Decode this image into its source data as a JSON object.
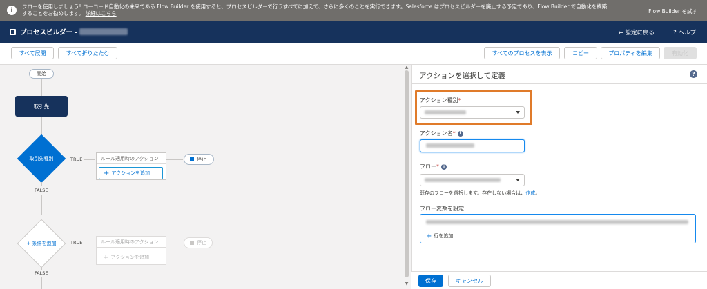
{
  "notice": {
    "text": "フローを使用しましょう! ローコード自動化の未来である Flow Builder を使用すると、プロセスビルダーで行うすべてに加えて、さらに多くのことを実行できます。Salesforce はプロセスビルダーを廃止する予定であり、Flow Builder で自動化を構築することをお勧めします。",
    "link": "詳細はこちら",
    "try_label": "Flow Builder を試す"
  },
  "header": {
    "title": "プロセスビルダー -",
    "back_label": "← 設定に戻る",
    "help_label": "? ヘルプ"
  },
  "toolbar": {
    "expand_all": "すべて展開",
    "collapse_all": "すべて折りたたむ",
    "show_all_processes": "すべてのプロセスを表示",
    "copy": "コピー",
    "edit_properties": "プロパティを編集",
    "activate": "有効化"
  },
  "canvas": {
    "start": "開始",
    "object_node": "取引先",
    "criteria1": "取引先種別",
    "criteria2": "+ 条件を追加",
    "true_label": "TRUE",
    "false_label": "FALSE",
    "immediate_actions": "ルール適用時のアクション",
    "add_action": "アクションを追加",
    "stop": "停止"
  },
  "panel": {
    "title": "アクションを選択して定義",
    "action_type_label": "アクション種別",
    "action_name_label": "アクション名",
    "flow_label": "フロー",
    "flow_help": "既存のフローを選択します。存在しない場合は、",
    "flow_help_link": "作成",
    "flow_vars_label": "フロー変数を設定",
    "add_row": "行を追加",
    "save": "保存",
    "cancel": "キャンセル"
  },
  "colors": {
    "header": "#16325c",
    "brand": "#0070d2",
    "notice": "#706e6b",
    "highlight": "#e07b2a"
  }
}
